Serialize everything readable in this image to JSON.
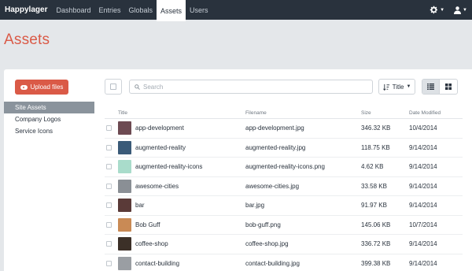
{
  "topbar": {
    "brand": "Happylager",
    "nav": [
      "Dashboard",
      "Entries",
      "Globals",
      "Assets",
      "Users"
    ],
    "active": "Assets"
  },
  "page": {
    "title": "Assets"
  },
  "sidebar": {
    "upload_label": "Upload files",
    "sources": [
      "Site Assets",
      "Company Logos",
      "Service Icons"
    ],
    "active_source": "Site Assets"
  },
  "toolbar": {
    "search_placeholder": "Search",
    "sort_label": "Title"
  },
  "table": {
    "headers": [
      "Title",
      "Filename",
      "Size",
      "Date Modified"
    ],
    "rows": [
      {
        "title": "app-development",
        "filename": "app-development.jpg",
        "size": "346.32 KB",
        "date": "10/4/2014",
        "thumb": "#6d4a52"
      },
      {
        "title": "augmented-reality",
        "filename": "augmented-reality.jpg",
        "size": "118.75 KB",
        "date": "9/14/2014",
        "thumb": "#3a5a78"
      },
      {
        "title": "augmented-reality-icons",
        "filename": "augmented-reality-icons.png",
        "size": "4.62 KB",
        "date": "9/14/2014",
        "thumb": "#a9dccb"
      },
      {
        "title": "awesome-cities",
        "filename": "awesome-cities.jpg",
        "size": "33.58 KB",
        "date": "9/14/2014",
        "thumb": "#8a8f95"
      },
      {
        "title": "bar",
        "filename": "bar.jpg",
        "size": "91.97 KB",
        "date": "9/14/2014",
        "thumb": "#5a3a38"
      },
      {
        "title": "Bob Guff",
        "filename": "bob-guff.png",
        "size": "145.06 KB",
        "date": "10/7/2014",
        "thumb": "#c98a55"
      },
      {
        "title": "coffee-shop",
        "filename": "coffee-shop.jpg",
        "size": "336.72 KB",
        "date": "9/14/2014",
        "thumb": "#3c3028"
      },
      {
        "title": "contact-building",
        "filename": "contact-building.jpg",
        "size": "399.38 KB",
        "date": "9/14/2014",
        "thumb": "#9a9ea3"
      }
    ]
  },
  "colors": {
    "accent": "#da5a47",
    "nav_bg": "#29323d",
    "active_source": "#8a939c"
  }
}
